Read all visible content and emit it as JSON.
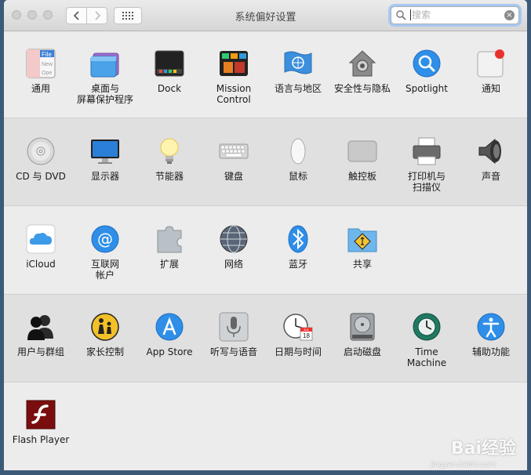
{
  "window": {
    "title": "系统偏好设置"
  },
  "search": {
    "placeholder": "搜索"
  },
  "rows": [
    [
      {
        "id": "general",
        "label": "通用"
      },
      {
        "id": "desktop",
        "label": "桌面与\n屏幕保护程序"
      },
      {
        "id": "dock",
        "label": "Dock"
      },
      {
        "id": "mission",
        "label": "Mission\nControl"
      },
      {
        "id": "language",
        "label": "语言与地区"
      },
      {
        "id": "security",
        "label": "安全性与隐私"
      },
      {
        "id": "spotlight",
        "label": "Spotlight"
      },
      {
        "id": "notifications",
        "label": "通知"
      }
    ],
    [
      {
        "id": "cddvd",
        "label": "CD 与 DVD"
      },
      {
        "id": "displays",
        "label": "显示器"
      },
      {
        "id": "energy",
        "label": "节能器"
      },
      {
        "id": "keyboard",
        "label": "键盘"
      },
      {
        "id": "mouse",
        "label": "鼠标"
      },
      {
        "id": "trackpad",
        "label": "触控板"
      },
      {
        "id": "printers",
        "label": "打印机与\n扫描仪"
      },
      {
        "id": "sound",
        "label": "声音"
      }
    ],
    [
      {
        "id": "icloud",
        "label": "iCloud"
      },
      {
        "id": "internet",
        "label": "互联网\n帐户"
      },
      {
        "id": "extensions",
        "label": "扩展"
      },
      {
        "id": "network",
        "label": "网络"
      },
      {
        "id": "bluetooth",
        "label": "蓝牙"
      },
      {
        "id": "sharing",
        "label": "共享"
      }
    ],
    [
      {
        "id": "users",
        "label": "用户与群组"
      },
      {
        "id": "parental",
        "label": "家长控制"
      },
      {
        "id": "appstore",
        "label": "App Store"
      },
      {
        "id": "dictation",
        "label": "听写与语音"
      },
      {
        "id": "datetime",
        "label": "日期与时间"
      },
      {
        "id": "startup",
        "label": "启动磁盘"
      },
      {
        "id": "timemachine",
        "label": "Time Machine"
      },
      {
        "id": "accessibility",
        "label": "辅助功能"
      }
    ],
    [
      {
        "id": "flash",
        "label": "Flash Player"
      }
    ]
  ],
  "icon_text": {
    "general_file": "File",
    "general_new": "New",
    "general_open": "Ope",
    "calendar_month": "JUL",
    "calendar_day": "18"
  },
  "watermark": {
    "logo": "Bai经验",
    "url": "jingyan.baidu.com"
  }
}
